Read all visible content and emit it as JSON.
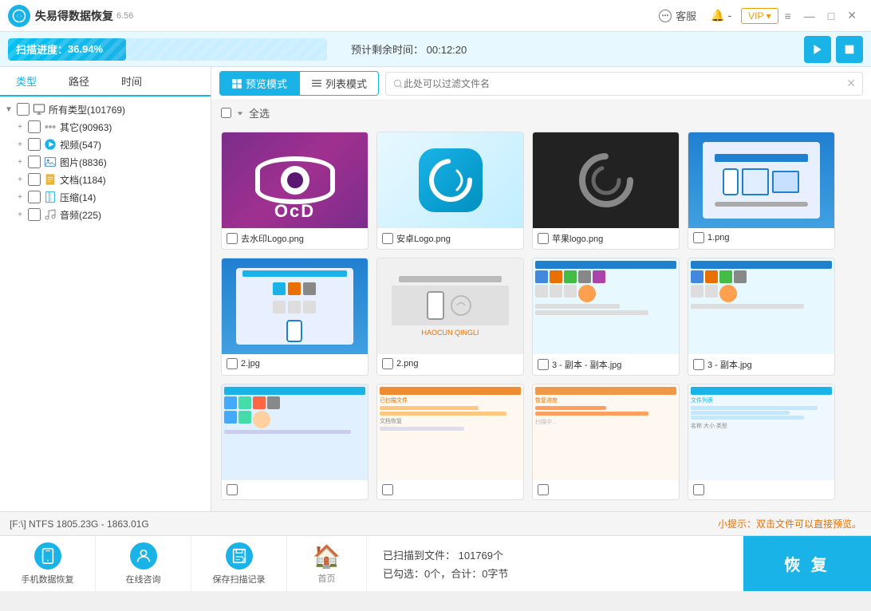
{
  "titlebar": {
    "app_name": "失易得数据恢复",
    "version": "6.56",
    "kefu_label": "客服",
    "bell_label": "-",
    "vip_label": "VIP",
    "minimize": "—",
    "maximize": "□",
    "close": "✕"
  },
  "progress": {
    "label": "扫描进度：",
    "percent_text": "36.94%",
    "percent_value": 36.94,
    "time_label": "预计剩余时间：",
    "time_value": "00:12:20"
  },
  "view_toggle": {
    "preview_label": "预览模式",
    "list_label": "列表模式",
    "filter_placeholder": "此处可以过滤文件名"
  },
  "tabs": {
    "type_label": "类型",
    "path_label": "路径",
    "time_label": "时间"
  },
  "tree": {
    "root": "所有类型(101769)",
    "items": [
      {
        "label": "其它(90963)",
        "type": "other"
      },
      {
        "label": "视频(547)",
        "type": "video"
      },
      {
        "label": "图片(8836)",
        "type": "image"
      },
      {
        "label": "文档(1184)",
        "type": "doc"
      },
      {
        "label": "压缩(14)",
        "type": "zip"
      },
      {
        "label": "音频(225)",
        "type": "audio"
      }
    ]
  },
  "select_all": "全选",
  "grid_items": [
    {
      "name": "去水印Logo.png"
    },
    {
      "name": "安卓Logo.png"
    },
    {
      "name": "苹果logo.png"
    },
    {
      "name": "1.png"
    },
    {
      "name": "2.jpg"
    },
    {
      "name": "2.png"
    },
    {
      "name": "3 - 副本 - 副本.jpg"
    },
    {
      "name": "3 - 副本.jpg"
    },
    {
      "name": ""
    },
    {
      "name": ""
    },
    {
      "name": ""
    },
    {
      "name": ""
    }
  ],
  "statusbar": {
    "path": "[F:\\] NTFS 1805.23G - 1863.01G",
    "tip": "小提示：双击文件可以直接预览。"
  },
  "footer": {
    "nav_items": [
      {
        "label": "手机数据恢复"
      },
      {
        "label": "在线咨询"
      },
      {
        "label": "保存扫描记录"
      }
    ],
    "home_label": "首页",
    "scanned_label": "已扫描到文件：",
    "scanned_count": "101769个",
    "checked_label": "已勾选：0个，合计：0字节",
    "restore_label": "恢 复"
  }
}
